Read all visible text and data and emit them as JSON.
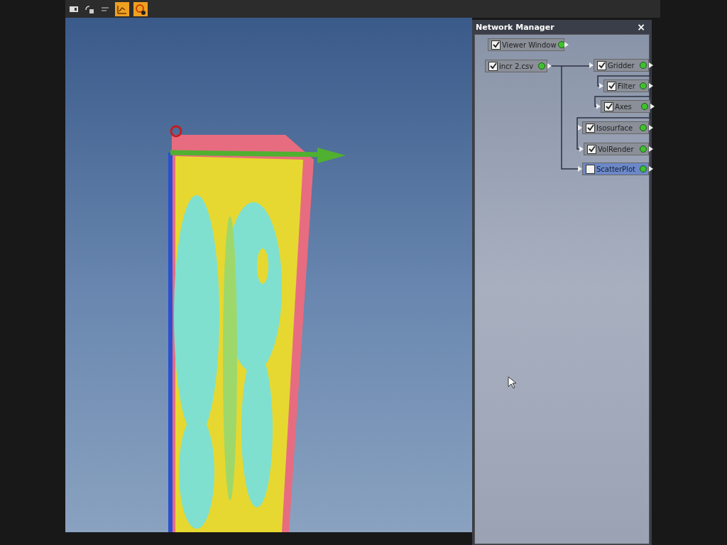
{
  "panel": {
    "title": "Network Manager",
    "close": "×"
  },
  "nodes": [
    {
      "label": "Viewer Window",
      "checked": true,
      "selected": false
    },
    {
      "label": "incr 2.csv",
      "checked": true,
      "selected": false
    },
    {
      "label": "Gridder",
      "checked": true,
      "selected": false
    },
    {
      "label": "Filter",
      "checked": true,
      "selected": false
    },
    {
      "label": "Axes",
      "checked": true,
      "selected": false
    },
    {
      "label": "Isosurface",
      "checked": true,
      "selected": false
    },
    {
      "label": "VolRender",
      "checked": true,
      "selected": false
    },
    {
      "label": "ScatterPlot",
      "checked": false,
      "selected": true
    }
  ]
}
